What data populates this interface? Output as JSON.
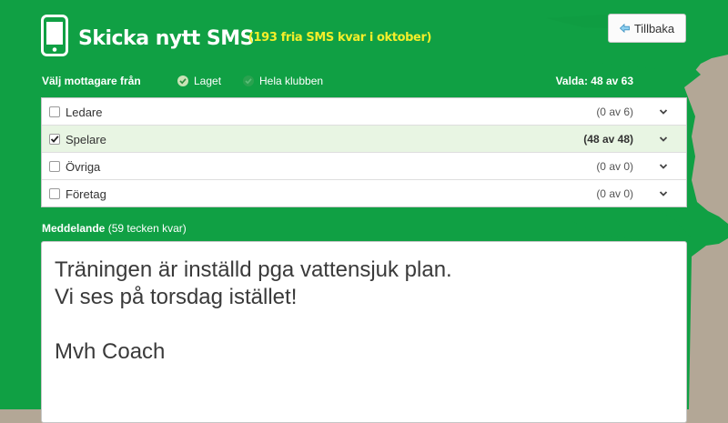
{
  "header": {
    "title": "Skicka nytt SMS",
    "free_sms": "(193 fria SMS kvar i oktober)",
    "back_label": "Tillbaka",
    "icons": {
      "phone": "phone-icon",
      "back": "arrow-left-icon"
    }
  },
  "recipients": {
    "label": "Välj mottagare från",
    "options": [
      {
        "label": "Laget",
        "selected": true
      },
      {
        "label": "Hela klubben",
        "selected": false
      }
    ],
    "selected_summary": "Valda: 48 av 63"
  },
  "groups": [
    {
      "name": "Ledare",
      "count": "(0 av 6)",
      "checked": false
    },
    {
      "name": "Spelare",
      "count": "(48 av 48)",
      "checked": true
    },
    {
      "name": "Övriga",
      "count": "(0 av 0)",
      "checked": false
    },
    {
      "name": "Företag",
      "count": "(0 av 0)",
      "checked": false
    }
  ],
  "message": {
    "label": "Meddelande",
    "remaining": "(59 tecken kvar)",
    "text": "Träningen är inställd pga vattensjuk plan.\nVi ses på torsdag istället!\n\nMvh Coach"
  },
  "colors": {
    "green": "#10a044",
    "background": "#b3a796",
    "free_sms_yellow": "#f3ee2a"
  }
}
